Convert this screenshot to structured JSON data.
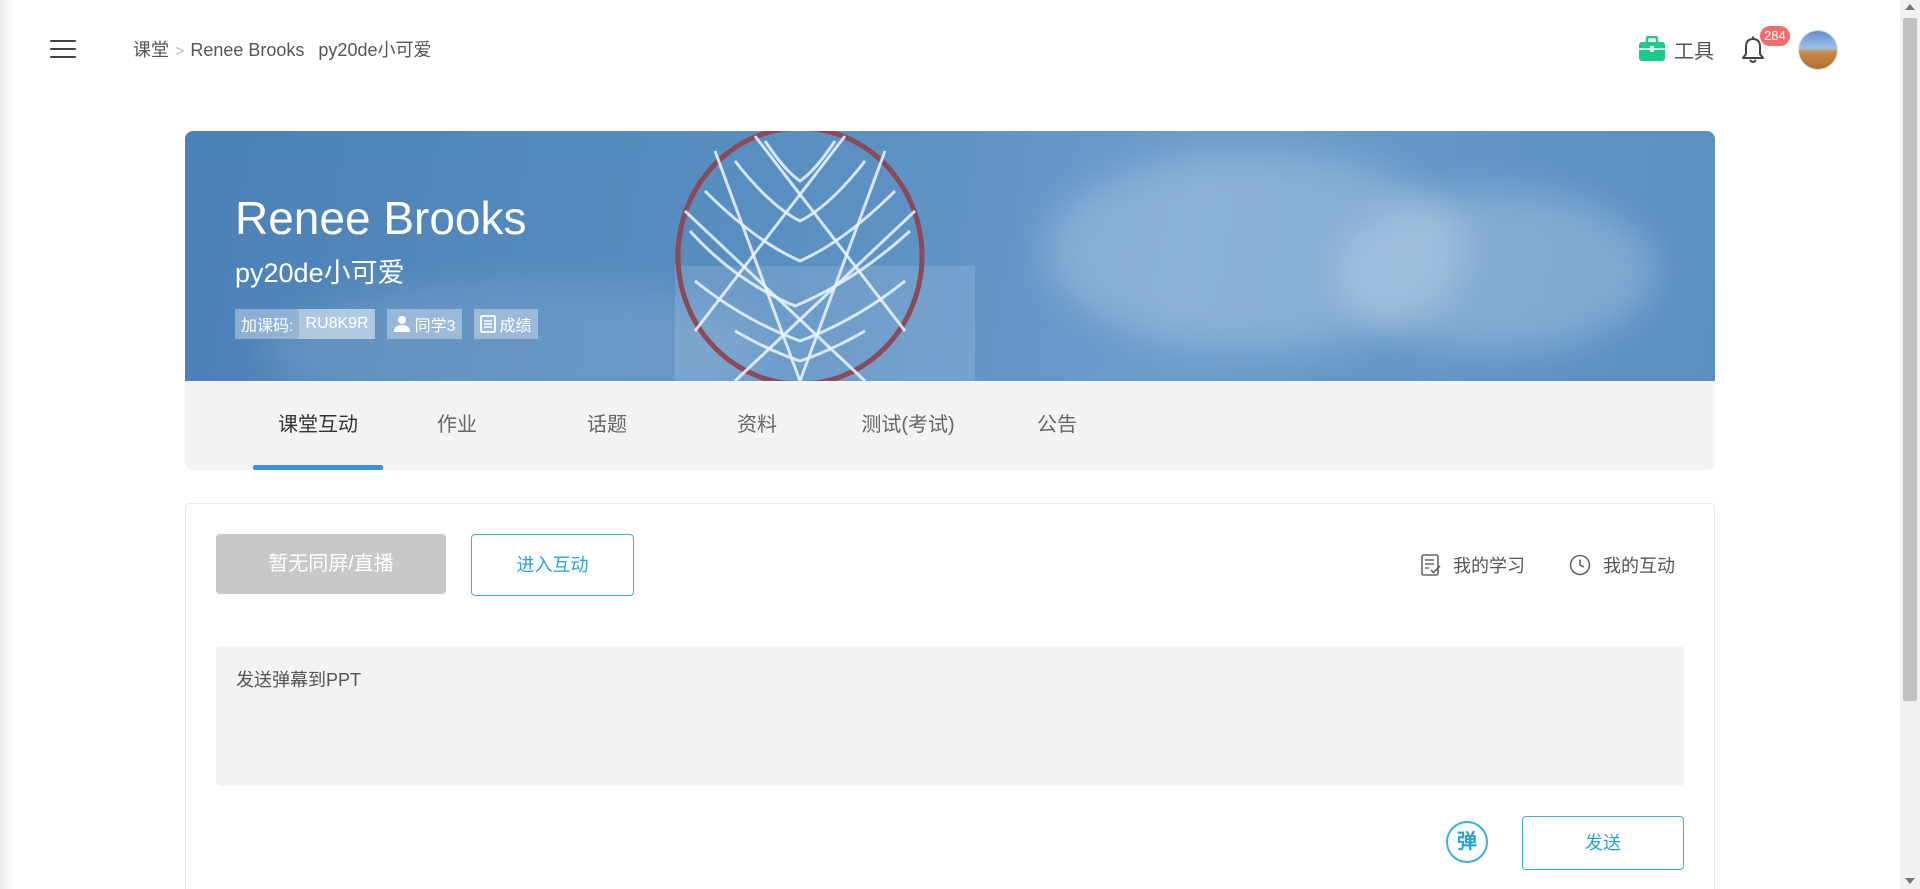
{
  "header": {
    "breadcrumb": {
      "root": "课堂",
      "separator": ">",
      "course": "Renee Brooks",
      "class": "py20de小可爱"
    },
    "tools_label": "工具",
    "notification_count": "284"
  },
  "course": {
    "title": "Renee Brooks",
    "subtitle": "py20de小可爱",
    "join_code_label": "加课码:",
    "join_code": "RU8K9R",
    "classmates_label": "同学3",
    "grades_label": "成绩"
  },
  "tabs": [
    {
      "label": "课堂互动",
      "active": true
    },
    {
      "label": "作业"
    },
    {
      "label": "话题"
    },
    {
      "label": "资料"
    },
    {
      "label": "测试(考试)"
    },
    {
      "label": "公告"
    }
  ],
  "interaction": {
    "live_button_label": "暂无同屏/直播",
    "enter_button_label": "进入互动",
    "my_study_label": "我的学习",
    "my_interaction_label": "我的互动",
    "danmaku_placeholder": "发送弹幕到PPT",
    "danmaku_toggle_label": "弹",
    "send_button_label": "发送"
  },
  "colors": {
    "accent": "#3b8eea",
    "link": "#2aa3d2",
    "badge": "#f56c6c",
    "tools_icon": "#1cc88a",
    "banner": "#5a8fc2"
  },
  "icons": {
    "menu": "hamburger-icon",
    "tools": "toolbox-icon",
    "bell": "bell-icon",
    "classmates": "person-icon",
    "grades": "document-icon",
    "my_study": "checklist-icon",
    "my_interaction": "clock-icon"
  }
}
